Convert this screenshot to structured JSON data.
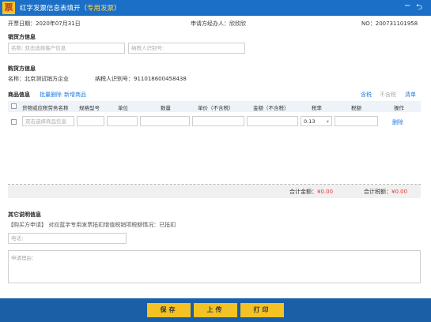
{
  "window": {
    "title_prefix": "红字发票信息表填开（",
    "title_highlight": "专用发票",
    "title_suffix": "）",
    "logo": "票",
    "minimize": "−",
    "back": "⮌"
  },
  "info": {
    "date": "开票日期：2020年07月31日",
    "applicant": "申请方经办人：欣欣欣",
    "number": "NO：200731101958"
  },
  "seller": {
    "title": "销货方信息",
    "name_placeholder": "名称: 双击选择客户信息",
    "taxid_placeholder": "纳税人识别号:"
  },
  "buyer": {
    "title": "购货方信息",
    "name": "名称：北京测试销方企业",
    "taxid": "纳税人识别号：911018600458438"
  },
  "goods": {
    "title": "商品信息",
    "batch_delete": "批量删除",
    "add_item": "新增商品",
    "tax_included": "含税",
    "tax_excluded": "不含税",
    "list": "清单",
    "columns": [
      "货物或应税劳务名称",
      "规格型号",
      "单位",
      "数量",
      "单价（不含税）",
      "金额（不含税）",
      "税率",
      "税额",
      "操作"
    ],
    "row": {
      "name_placeholder": "双击选择商品信息",
      "tax_rate": "0.13",
      "delete": "删除"
    }
  },
  "summary": {
    "total_amount_label": "合计金额：",
    "total_amount_value": "¥0.00",
    "total_tax_label": "合计税额：",
    "total_tax_value": "¥0.00"
  },
  "other": {
    "title": "其它说明信息",
    "note": "【购买方申请】 对应蓝字专用发票抵扣增值税销项税额情况：已抵扣",
    "phone_placeholder": "电话：",
    "reason_placeholder": "申请理由："
  },
  "footer": {
    "save": "保存",
    "upload": "上传",
    "print": "打印"
  }
}
